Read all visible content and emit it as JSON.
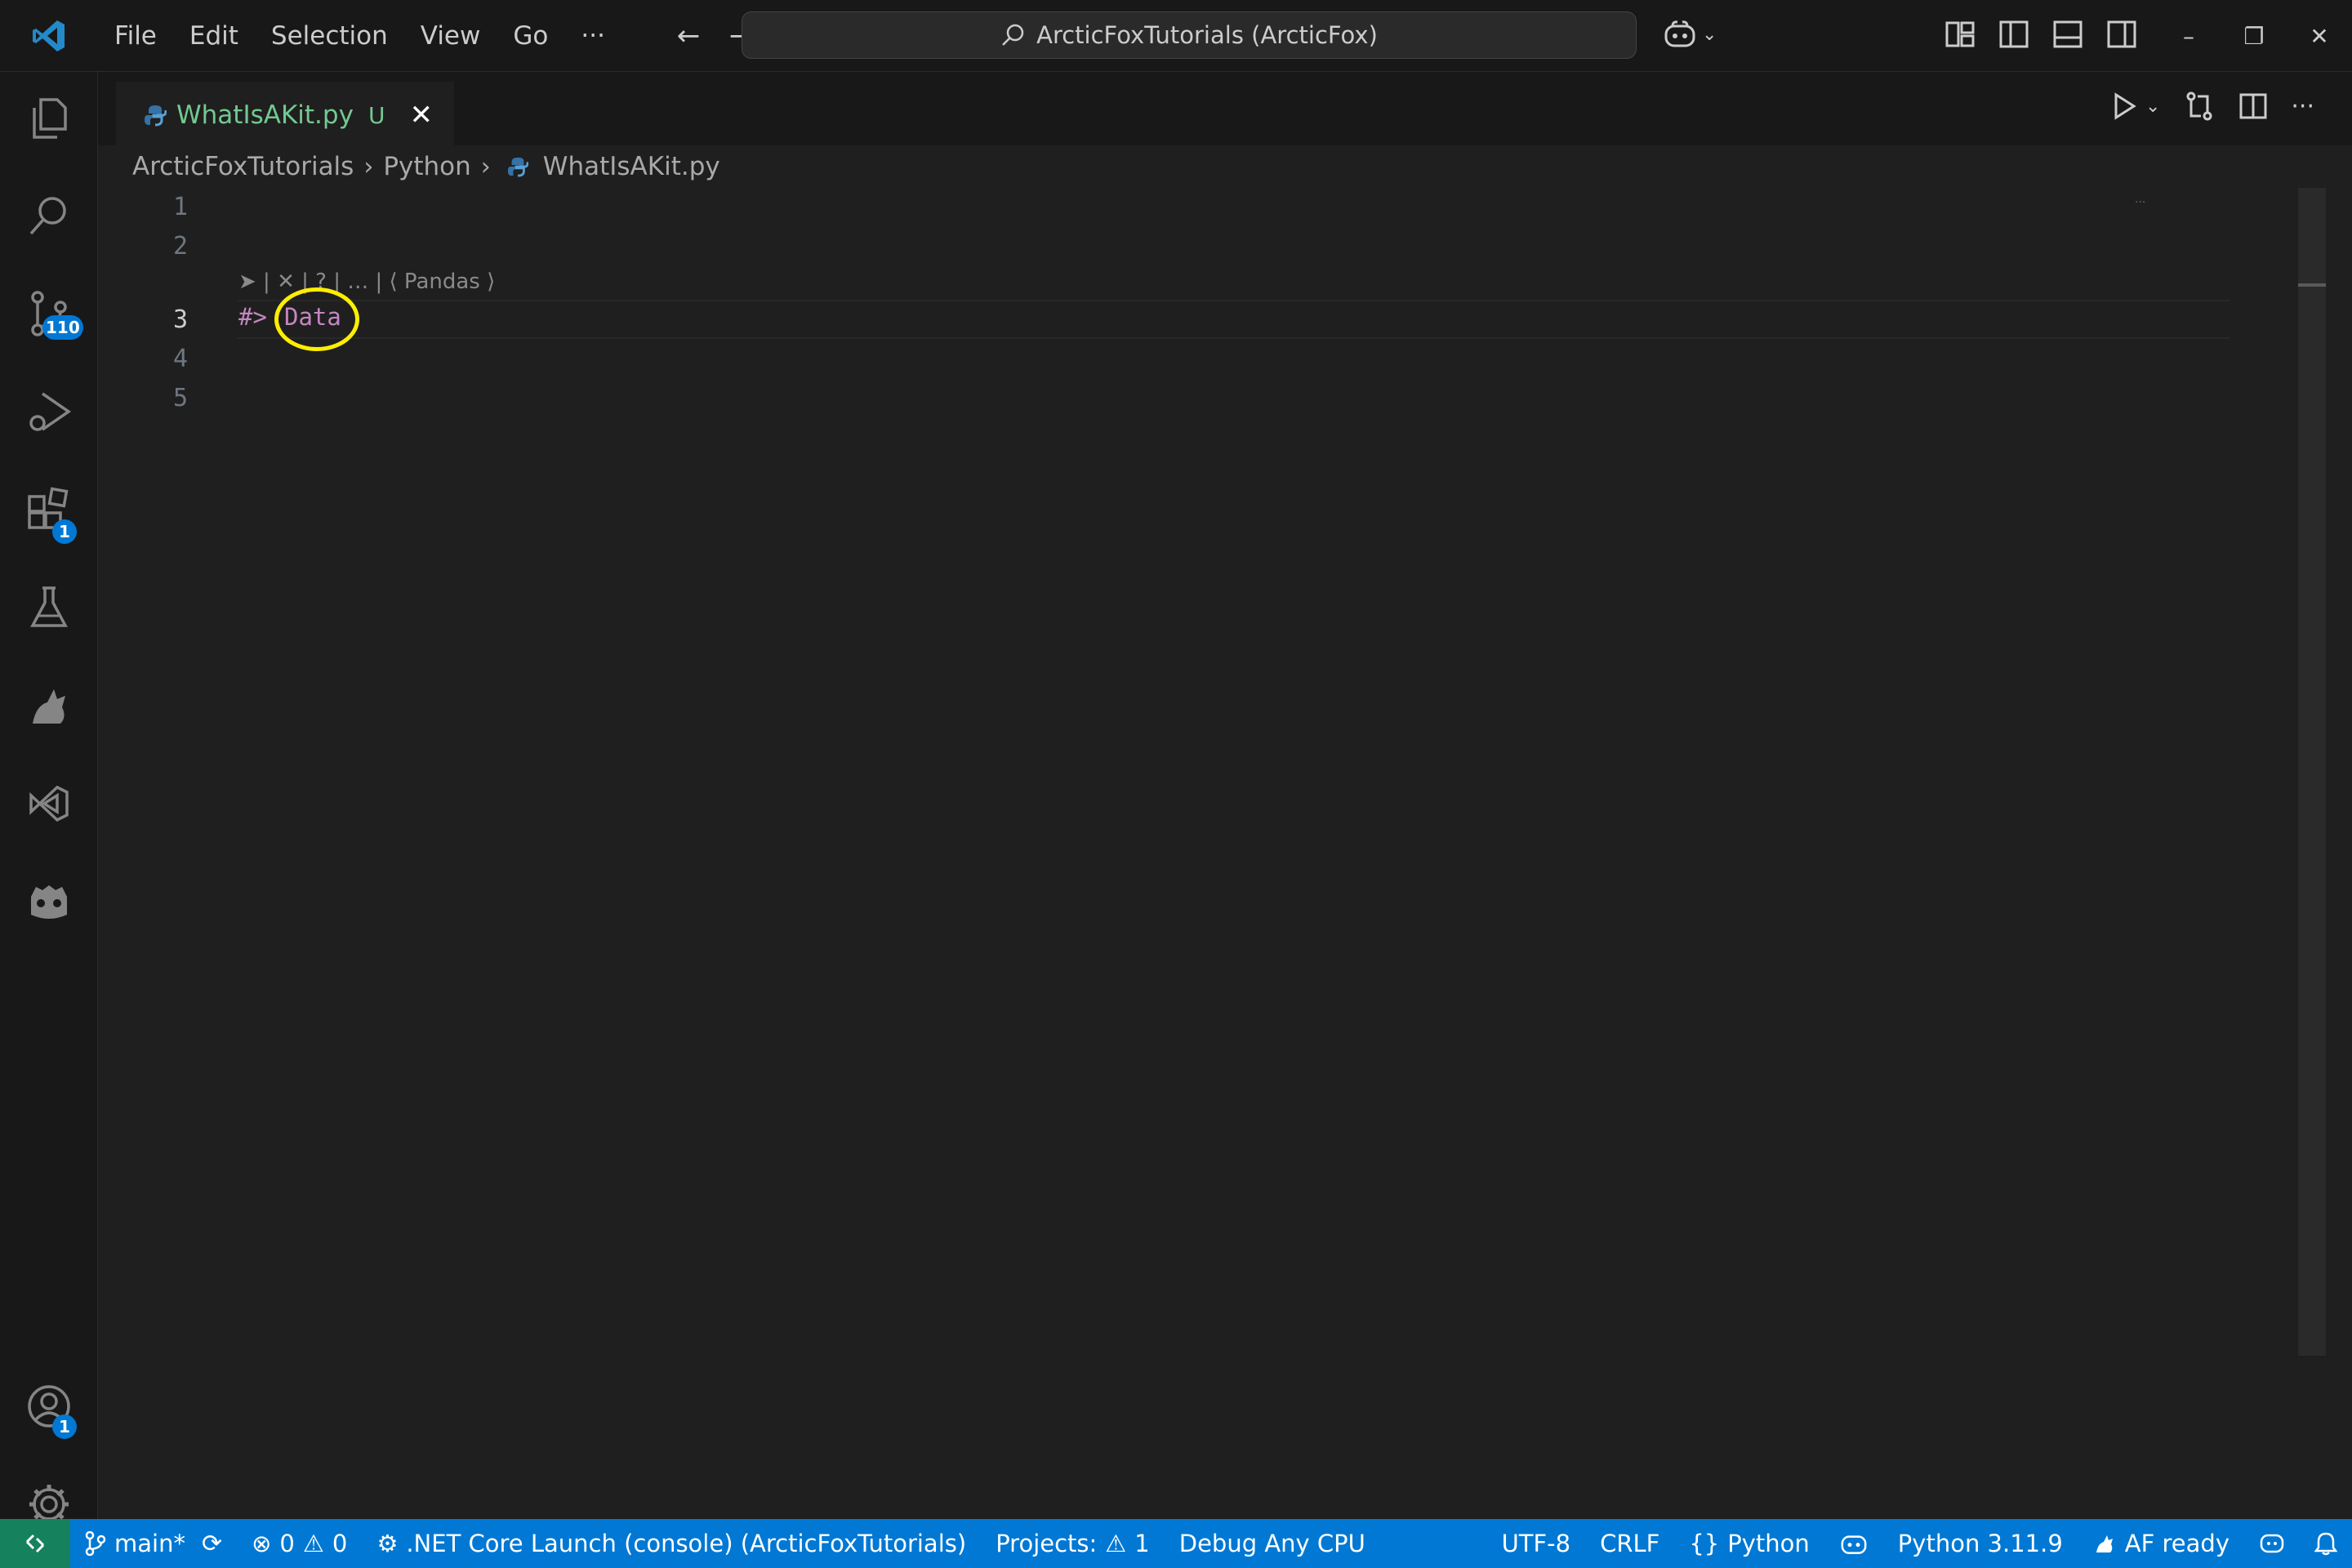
{
  "menu": [
    "File",
    "Edit",
    "Selection",
    "View",
    "Go",
    "···"
  ],
  "command_center": "ArcticFoxTutorials (ArcticFox)",
  "tab": {
    "label": "WhatIsAKit.py",
    "status": "U"
  },
  "breadcrumb": {
    "folder": "ArcticFoxTutorials",
    "subfolder": "Python",
    "file": "WhatIsAKit.py"
  },
  "activity_badges": {
    "source_control": "110",
    "extensions": "1",
    "accounts": "1"
  },
  "editor": {
    "line_numbers": [
      "1",
      "2",
      "3",
      "4",
      "5"
    ],
    "codelens": "➤ | ✕ | ? | … | ⟨ Pandas ⟩",
    "code_prefix": "#>",
    "code_word": "Data"
  },
  "statusbar": {
    "branch": "main*",
    "errors": "0",
    "warnings": "0",
    "launch": ".NET Core Launch (console) (ArcticFoxTutorials)",
    "projects": "Projects:",
    "projects_count": "1",
    "debug": "Debug Any CPU",
    "encoding": "UTF-8",
    "eol": "CRLF",
    "language": "Python",
    "interpreter": "Python 3.11.9",
    "af_status": "AF ready"
  },
  "colors": {
    "accent": "#0078d4",
    "remote": "#16825d",
    "highlight_ring": "#ffee00",
    "keyword": "#c586c0",
    "untracked": "#73c991"
  }
}
